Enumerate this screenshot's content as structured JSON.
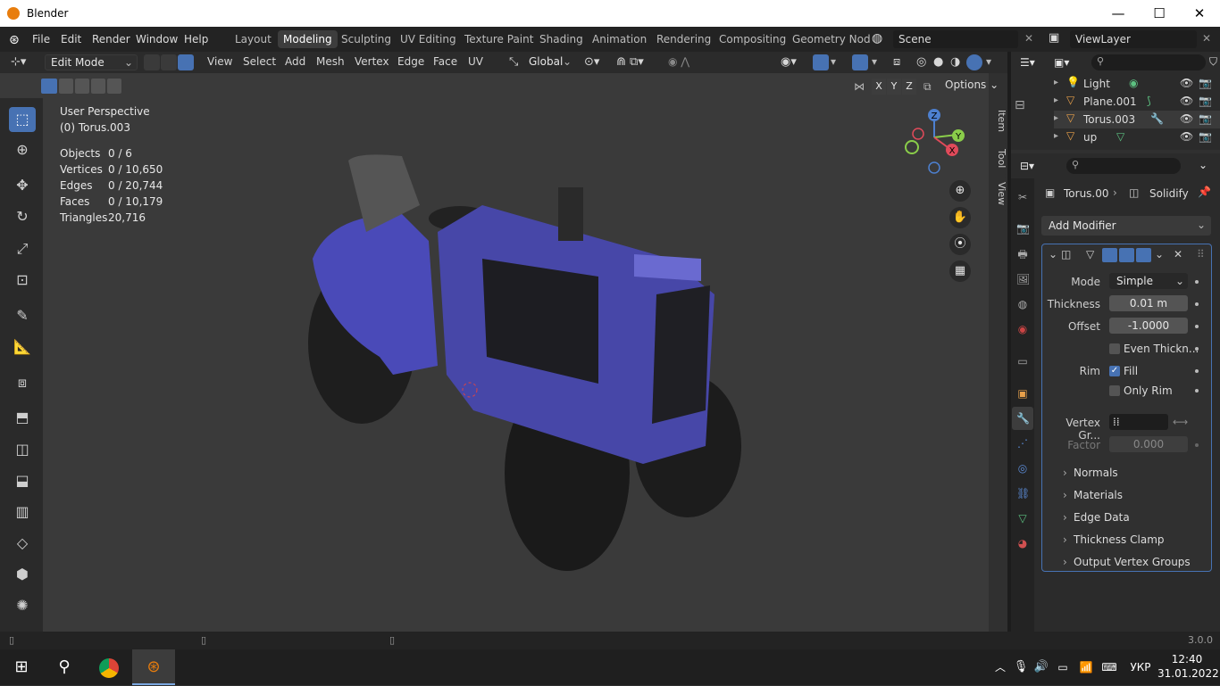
{
  "window": {
    "title": "Blender",
    "minimize": "—",
    "maximize": "☐",
    "close": "✕"
  },
  "menu": [
    "File",
    "Edit",
    "Render",
    "Window",
    "Help"
  ],
  "workspaces": [
    "Layout",
    "Modeling",
    "Sculpting",
    "UV Editing",
    "Texture Paint",
    "Shading",
    "Animation",
    "Rendering",
    "Compositing",
    "Geometry Nod"
  ],
  "scene": "Scene",
  "view_layer": "ViewLayer",
  "header": {
    "mode": "Edit Mode",
    "menus": [
      "View",
      "Select",
      "Add",
      "Mesh",
      "Vertex",
      "Edge",
      "Face",
      "UV"
    ],
    "orientation": "Global",
    "options": "Options",
    "axes": [
      "X",
      "Y",
      "Z"
    ]
  },
  "viewport": {
    "perspective": "User Perspective",
    "object": "(0) Torus.003",
    "stats": [
      {
        "label": "Objects",
        "value": "0 / 6"
      },
      {
        "label": "Vertices",
        "value": "0 / 10,650"
      },
      {
        "label": "Edges",
        "value": "0 / 20,744"
      },
      {
        "label": "Faces",
        "value": "0 / 10,179"
      },
      {
        "label": "Triangles",
        "value": "20,716"
      }
    ],
    "side_tabs": [
      "Item",
      "Tool",
      "View"
    ],
    "gizmo": {
      "z": "Z",
      "y": "Y",
      "x": "X"
    }
  },
  "outliner": {
    "items": [
      {
        "name": "Light",
        "color": "#e8a04a"
      },
      {
        "name": "Plane.001",
        "color": "#e8a04a"
      },
      {
        "name": "Torus.003",
        "color": "#e8a04a"
      },
      {
        "name": "up",
        "color": "#e8a04a"
      }
    ]
  },
  "properties": {
    "breadcrumb_object": "Torus.00",
    "breadcrumb_modifier": "Solidify",
    "add_modifier": "Add Modifier",
    "mode_label": "Mode",
    "mode_value": "Simple",
    "thickness_label": "Thickness",
    "thickness_value": "0.01 m",
    "offset_label": "Offset",
    "offset_value": "-1.0000",
    "even_thickness": "Even Thickn...",
    "rim_label": "Rim",
    "fill": "Fill",
    "only_rim": "Only Rim",
    "vertex_group_label": "Vertex Gr...",
    "factor_label": "Factor",
    "factor_value": "0.000",
    "subpanels": [
      "Normals",
      "Materials",
      "Edge Data",
      "Thickness Clamp",
      "Output Vertex Groups"
    ]
  },
  "status": {
    "version": "3.0.0"
  },
  "taskbar": {
    "language": "УКР",
    "time": "12:40",
    "date": "31.01.2022"
  },
  "colors": {
    "accent": "#4772b3",
    "tractor": "#4a4ab8",
    "brand": "#e87d0d"
  }
}
